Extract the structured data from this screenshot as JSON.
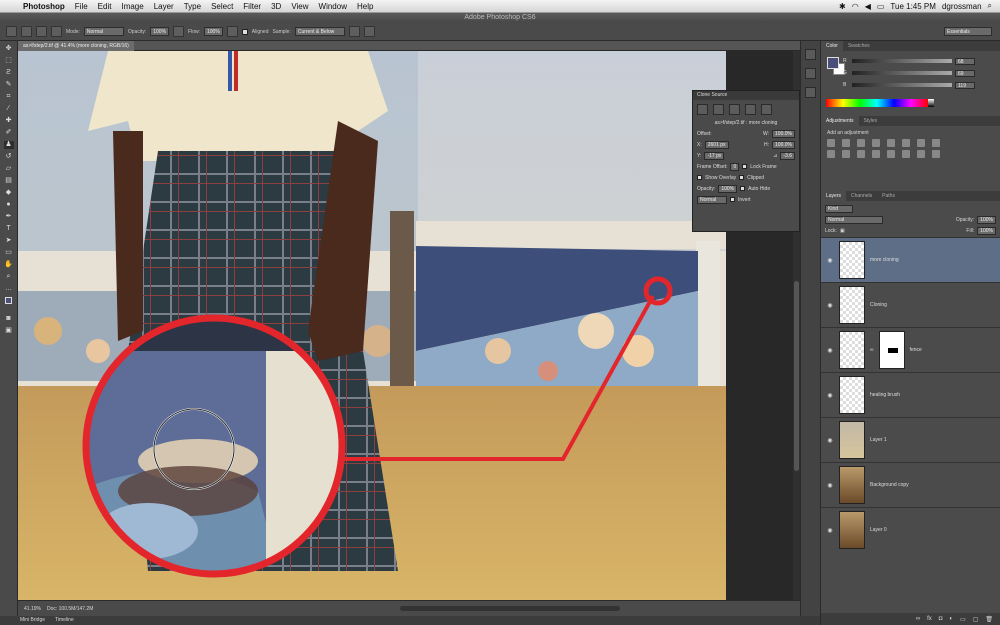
{
  "menubar": {
    "app": "Photoshop",
    "items": [
      "File",
      "Edit",
      "Image",
      "Layer",
      "Type",
      "Select",
      "Filter",
      "3D",
      "View",
      "Window",
      "Help"
    ],
    "clock": "Tue 1:45 PM",
    "user": "dgrossman"
  },
  "window_title": "Adobe Photoshop CS6",
  "options": {
    "mode_label": "Mode:",
    "mode_value": "Normal",
    "opacity_label": "Opacity:",
    "opacity_value": "100%",
    "flow_label": "Flow:",
    "flow_value": "100%",
    "aligned_label": "Aligned",
    "sample_label": "Sample:",
    "sample_value": "Current & Below",
    "workspace": "Essentials"
  },
  "document": {
    "tab": "as>f/step/2.tif @ 41.4% (more cloning, RGB/16)"
  },
  "status": {
    "zoom": "41.19%",
    "doc": "Doc: 100.5M/147.2M"
  },
  "bottom_tabs": [
    "Mini Bridge",
    "Timeline"
  ],
  "color_panel": {
    "tabs": [
      "Color",
      "Swatches"
    ],
    "rows": [
      {
        "label": "R",
        "value": "68"
      },
      {
        "label": "G",
        "value": "69"
      },
      {
        "label": "B",
        "value": "119"
      }
    ]
  },
  "adjust_panel": {
    "tabs": [
      "Adjustments",
      "Styles"
    ],
    "subtitle": "Add an adjustment"
  },
  "layers_panel": {
    "tabs": [
      "Layers",
      "Channels",
      "Paths"
    ],
    "kind": "Kind",
    "blend": "Normal",
    "opacity_label": "Opacity:",
    "opacity": "100%",
    "lock_label": "Lock:",
    "fill_label": "Fill:",
    "fill": "100%",
    "layers": [
      {
        "name": "more cloning",
        "type": "trans",
        "selected": true
      },
      {
        "name": "Cloning",
        "type": "trans",
        "selected": false
      },
      {
        "name": "fence",
        "type": "mask",
        "selected": false
      },
      {
        "name": "healing brush",
        "type": "trans",
        "selected": false
      },
      {
        "name": "Layer 1",
        "type": "scene",
        "selected": false
      },
      {
        "name": "Background copy",
        "type": "photo",
        "selected": false
      },
      {
        "name": "Layer 0",
        "type": "photo",
        "selected": false
      }
    ]
  },
  "clone_source": {
    "title": "Clone Source",
    "source_name": "as>f/step/2.tif : more cloning",
    "offset_label": "Offset:",
    "x": "2601 px",
    "y": "-17 px",
    "w": "100.0%",
    "h": "100.0%",
    "angle": "-3.6",
    "frame_offset_label": "Frame Offset:",
    "frame_offset": "0",
    "lock_frame": "Lock Frame",
    "show_overlay": "Show Overlay",
    "clipped": "Clipped",
    "opacity_label": "Opacity:",
    "opacity": "100%",
    "auto_hide": "Auto Hide",
    "blend": "Normal",
    "invert": "Invert"
  },
  "colors": {
    "annotation_red": "#e3262b",
    "selected_layer": "#5d6e86"
  }
}
